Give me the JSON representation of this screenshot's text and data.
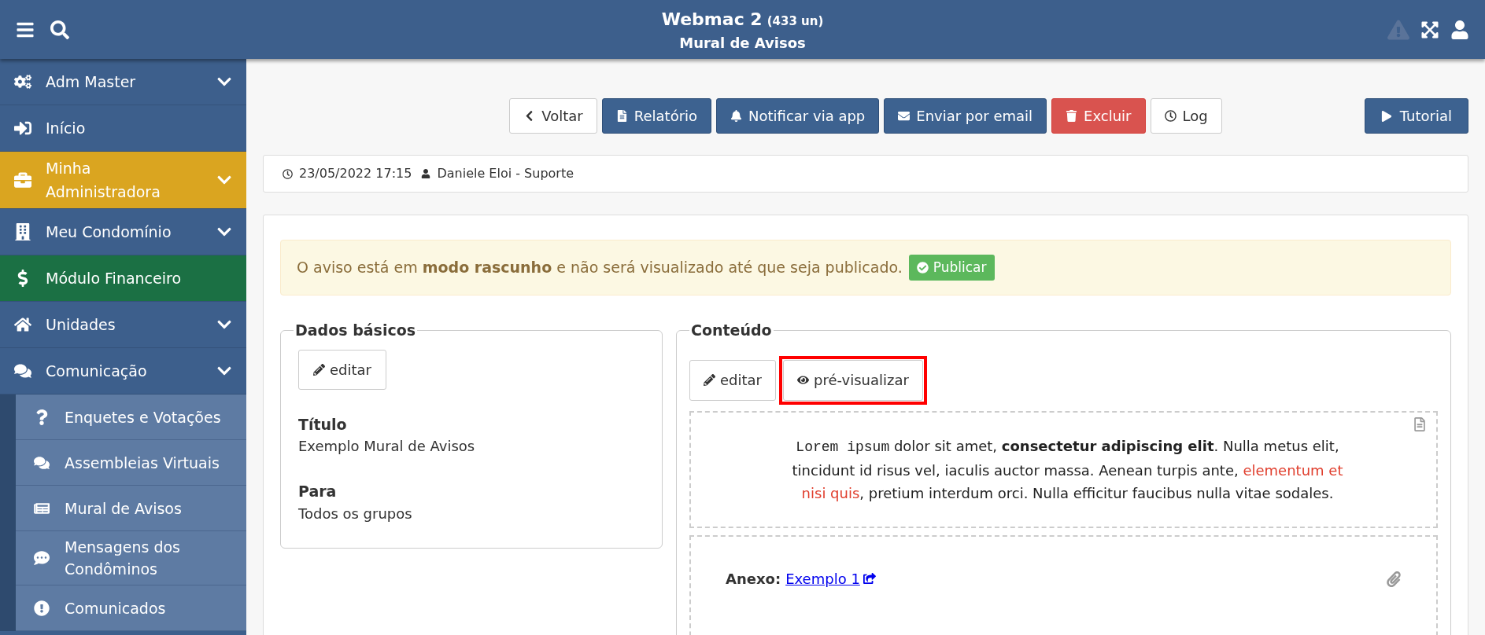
{
  "header": {
    "title": "Webmac 2",
    "count": "(433 un)",
    "subtitle": "Mural de Avisos"
  },
  "sidebar": {
    "items": [
      {
        "label": "Adm Master",
        "expandable": true,
        "color": "#3d5f8c"
      },
      {
        "label": "Início",
        "expandable": false,
        "color": "#3d5f8c"
      },
      {
        "label": "Minha Administradora",
        "expandable": true,
        "color": "#daa520"
      },
      {
        "label": "Meu Condomínio",
        "expandable": true,
        "color": "#3d5f8c"
      },
      {
        "label": "Módulo Financeiro",
        "expandable": false,
        "color": "#1b7044"
      },
      {
        "label": "Unidades",
        "expandable": true,
        "color": "#3d5f8c"
      },
      {
        "label": "Comunicação",
        "expandable": true,
        "color": "#3d5f8c",
        "children": [
          {
            "label": "Enquetes e Votações"
          },
          {
            "label": "Assembleias Virtuais"
          },
          {
            "label": "Mural de Avisos"
          },
          {
            "label": "Mensagens dos Condôminos"
          },
          {
            "label": "Comunicados"
          }
        ]
      }
    ]
  },
  "toolbar": {
    "buttons": [
      {
        "label": "Voltar",
        "kind": "default"
      },
      {
        "label": "Relatório",
        "kind": "primary"
      },
      {
        "label": "Notificar via app",
        "kind": "primary"
      },
      {
        "label": "Enviar por email",
        "kind": "primary"
      },
      {
        "label": "Excluir",
        "kind": "danger"
      },
      {
        "label": "Log",
        "kind": "default"
      }
    ],
    "tutorial": "Tutorial"
  },
  "info": {
    "date": "23/05/2022 17:15",
    "author": "Daniele Eloi - Suporte"
  },
  "alert": {
    "text": "O aviso está em **modo rascunho** e não será visualizado até que seja publicado.",
    "button": "Publicar"
  },
  "basic": {
    "legend": "Dados básicos",
    "edit": "editar",
    "fields": [
      {
        "label": "Título",
        "value": "Exemplo Mural de Avisos"
      },
      {
        "label": "Para",
        "value": "Todos os grupos"
      }
    ]
  },
  "content": {
    "legend": "Conteúdo",
    "tabs": [
      {
        "label": "editar",
        "highlighted": false
      },
      {
        "label": "pré-visualizar",
        "highlighted": true
      }
    ],
    "body": [
      {
        "kind": "code",
        "text": "Lorem ipsum"
      },
      {
        "kind": "text",
        "text": " dolor sit amet, "
      },
      {
        "kind": "bold",
        "text": "consectetur adipiscing elit"
      },
      {
        "kind": "text",
        "text": ". Nulla metus elit, tincidunt id risus vel, iaculis auctor massa. Aenean turpis ante, "
      },
      {
        "kind": "red",
        "text": "elementum et nisi quis"
      },
      {
        "kind": "text",
        "text": ", pretium interdum orci. Nulla efficitur faucibus nulla vitae sodales."
      }
    ],
    "attachment": {
      "label": "Anexo:",
      "link": "Exemplo 1"
    }
  }
}
